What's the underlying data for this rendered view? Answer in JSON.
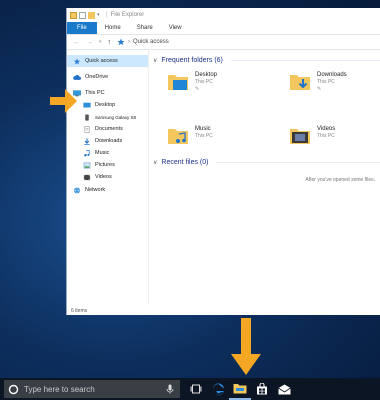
{
  "window": {
    "title": "File Explorer"
  },
  "ribbon": {
    "tabs": [
      "File",
      "Home",
      "Share",
      "View"
    ]
  },
  "address": {
    "path": "Quick access"
  },
  "nav": {
    "items": [
      {
        "label": "Quick access"
      },
      {
        "label": "OneDrive"
      },
      {
        "label": "This PC"
      },
      {
        "label": "Desktop"
      },
      {
        "label": "Samsung Galaxy S8"
      },
      {
        "label": "Documents"
      },
      {
        "label": "Downloads"
      },
      {
        "label": "Music"
      },
      {
        "label": "Pictures"
      },
      {
        "label": "Videos"
      },
      {
        "label": "Network"
      }
    ]
  },
  "frequent": {
    "header": "Frequent folders (6)",
    "folders": [
      {
        "name": "Desktop",
        "location": "This PC"
      },
      {
        "name": "Downloads",
        "location": "This PC"
      },
      {
        "name": "Music",
        "location": "This PC"
      },
      {
        "name": "Videos",
        "location": "This PC"
      }
    ]
  },
  "recent": {
    "header": "Recent files (0)",
    "empty_message": "After you've opened some files,"
  },
  "status": {
    "items": "6 items"
  },
  "taskbar": {
    "search_placeholder": "Type here to search"
  },
  "colors": {
    "accent": "#1979ca",
    "arrow": "#f5a623",
    "folder": "#f3c75d"
  }
}
